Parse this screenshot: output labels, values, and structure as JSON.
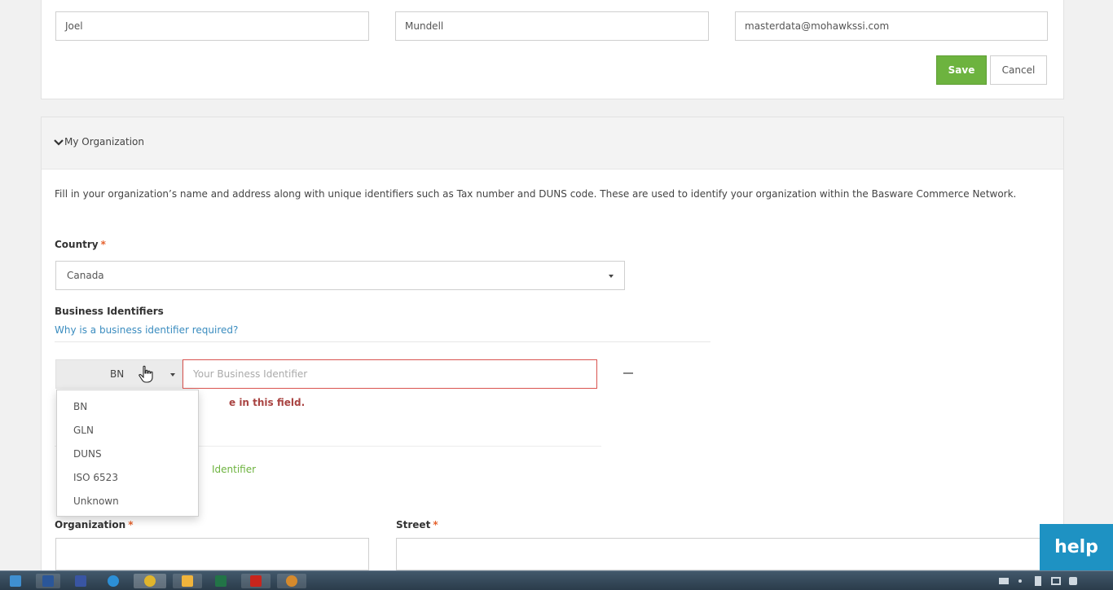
{
  "contact": {
    "first_name": "Joel",
    "last_name": "Mundell",
    "email": "masterdata@mohawkssi.com",
    "save_label": "Save",
    "cancel_label": "Cancel"
  },
  "organization": {
    "section_title": "My Organization",
    "description": "Fill in your organization’s name and address along with unique identifiers such as Tax number and DUNS code. These are used to identify your organization within the Basware Commerce Network.",
    "country_label": "Country",
    "required_mark": "*",
    "country_value": "Canada",
    "business_identifiers_label": "Business Identifiers",
    "why_link": "Why is a business identifier required?",
    "identifier_type": "BN",
    "identifier_placeholder": "Your Business Identifier",
    "error_text_visible": "e in this field.",
    "add_identifier_visible": "Identifier",
    "identifier_options": [
      "BN",
      "GLN",
      "DUNS",
      "ISO 6523",
      "Unknown"
    ],
    "organization_label": "Organization",
    "street_label": "Street"
  },
  "help_label": "help",
  "colors": {
    "save_green": "#6db33f",
    "help_blue": "#1e92c3",
    "error_red": "#a94442",
    "required_orange": "#e5622e",
    "link_blue": "#3a8cbf"
  },
  "taskbar": {
    "icons": [
      "windows-start-icon",
      "word-icon",
      "visio-icon",
      "ie-icon",
      "chrome-icon",
      "outlook-icon",
      "excel-icon",
      "acrobat-icon",
      "app-icon"
    ]
  }
}
